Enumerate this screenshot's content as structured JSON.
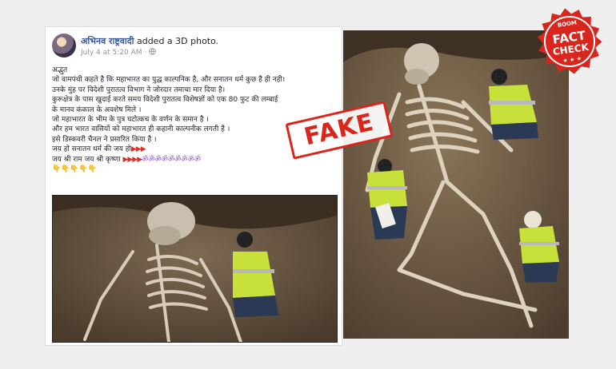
{
  "post": {
    "author": "अभिनव राष्ट्रवादी",
    "action": "added a 3D photo.",
    "timestamp": "July 4 at 5:20 AM",
    "lines": [
      "अद्भुत",
      "जो वामपंथी कहते है कि महाभारत का युद्ध काल्पनिक है, और सनातन धर्म कुछ है ही नही।",
      "उनके मुंह पर विदेशी पुरातत्व विभाग ने जोरदार तमाचा मार दिया है।",
      "कुरूक्षेत्र के पास खुदाई करते समय विदेशी पुरातत्व विशेषज्ञों को एक 80 फुट की लम्बाई",
      "के मानव कंकाल के अवशेष मिले ।",
      "जो महाभारत के भीम के पुत्र घटोत्कच के वर्णन के समान है ।",
      "और हम भारत वासियों को महाभारत ही कहानी काल्पनीक लगती है ।",
      "इसे डिस्कवरी चैनल ने प्रसारित किया है ।"
    ],
    "slogan1": "जय हो सनातन धर्म की जय हो",
    "slogan2": "जय श्री राम जय श्री कृष्णा",
    "flags1": "▶▶▶",
    "flags2": "▶▶▶▶",
    "oms": "ॐॐॐॐॐॐॐॐॐ",
    "hands": "👇👇👇👇👇"
  },
  "stamp": {
    "label": "FAKE"
  },
  "badge": {
    "top": "BOOM",
    "line1": "FACT",
    "line2": "CHECK",
    "stars": "★ ★ ★"
  },
  "colors": {
    "fake": "#d9251c",
    "link": "#385898"
  }
}
